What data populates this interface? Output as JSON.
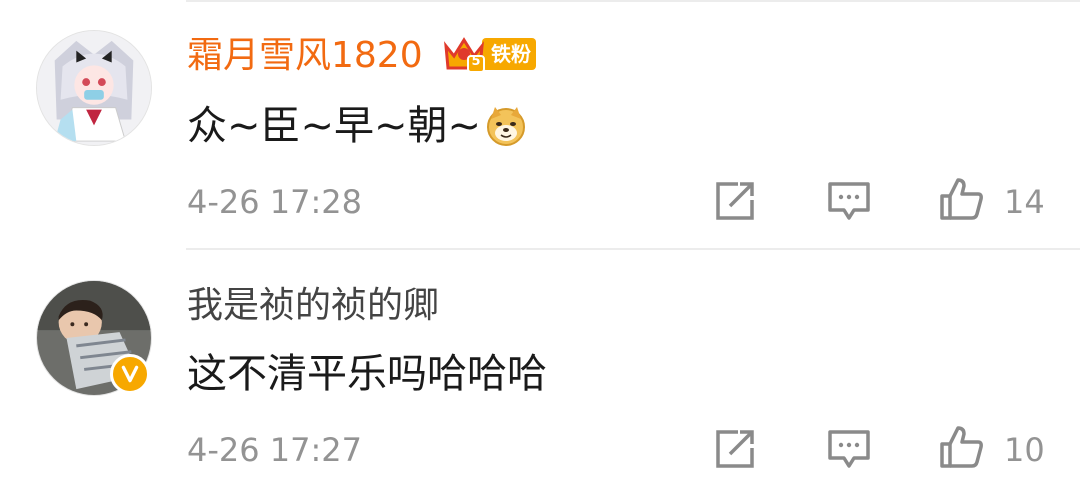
{
  "comments": [
    {
      "username": "霜月雪风1820",
      "badge": {
        "level": "5",
        "label": "铁粉"
      },
      "text": "众~臣~早~朝~",
      "emoji": "doge-emoji",
      "timestamp": "4-26 17:28",
      "likes": "14"
    },
    {
      "username": "我是祯的祯的卿",
      "verified": true,
      "text": "这不清平乐吗哈哈哈",
      "timestamp": "4-26 17:27",
      "likes": "10"
    }
  ],
  "colors": {
    "vip_name": "#f26a11",
    "normal_name": "#444444",
    "meta": "#939393",
    "badge_gold": "#f7a800"
  },
  "icons": [
    "share-icon",
    "comment-icon",
    "like-icon",
    "verified-icon"
  ]
}
